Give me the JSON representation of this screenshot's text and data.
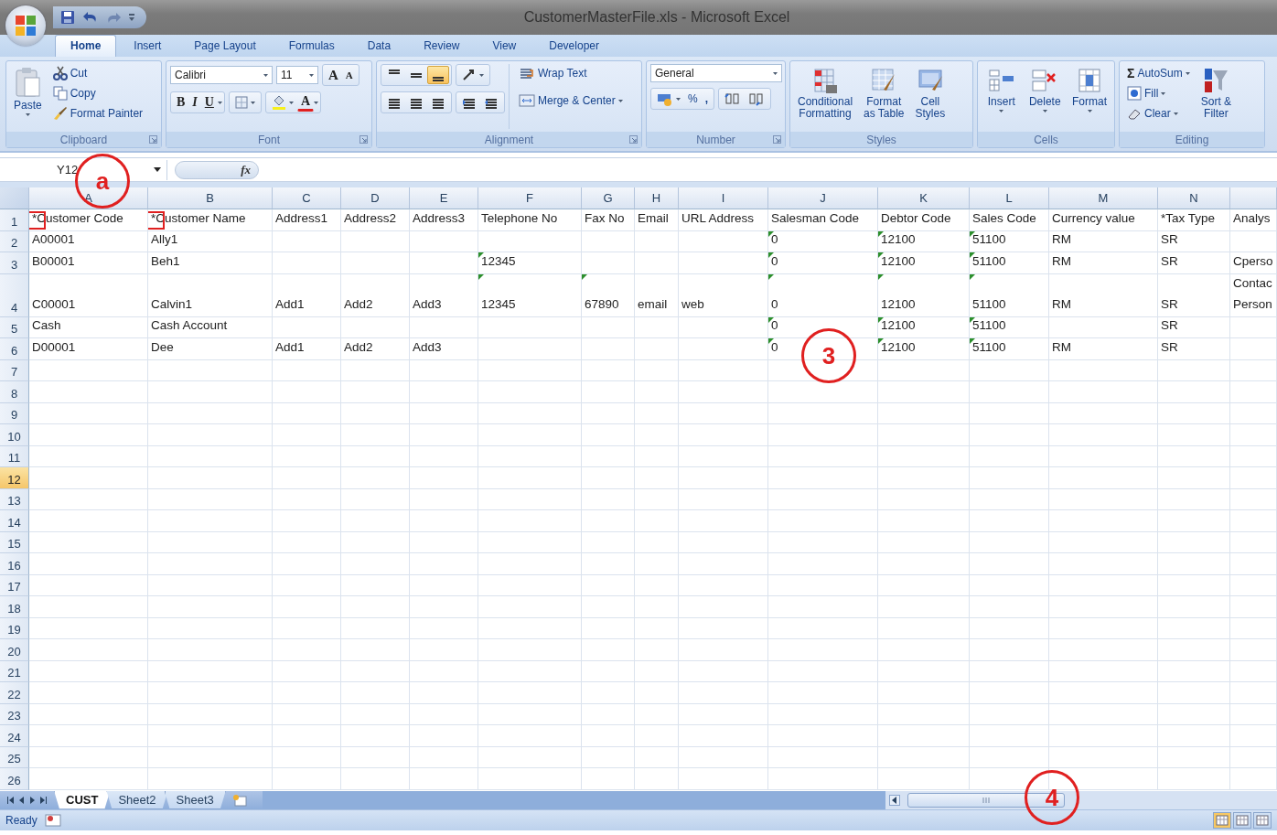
{
  "title_bar": {
    "title": "CustomerMasterFile.xls - Microsoft Excel"
  },
  "ribbon_tabs": [
    {
      "label": "Home",
      "selected": true
    },
    {
      "label": "Insert",
      "selected": false
    },
    {
      "label": "Page Layout",
      "selected": false
    },
    {
      "label": "Formulas",
      "selected": false
    },
    {
      "label": "Data",
      "selected": false
    },
    {
      "label": "Review",
      "selected": false
    },
    {
      "label": "View",
      "selected": false
    },
    {
      "label": "Developer",
      "selected": false
    }
  ],
  "ribbon": {
    "clipboard": {
      "label": "Clipboard",
      "paste": "Paste",
      "cut": "Cut",
      "copy": "Copy",
      "format_painter": "Format Painter"
    },
    "font": {
      "label": "Font",
      "font_name": "Calibri",
      "font_size": "11",
      "grow": "A",
      "shrink": "A",
      "bold": "B",
      "italic": "I",
      "underline": "U",
      "font_color": "A"
    },
    "alignment": {
      "label": "Alignment",
      "vertical_buttons": [
        {
          "selected": false
        },
        {
          "selected": false
        },
        {
          "selected": true
        }
      ],
      "wrap_text": "Wrap Text",
      "merge_center": "Merge & Center"
    },
    "number": {
      "label": "Number",
      "format": "General",
      "percent": "%",
      "comma": ","
    },
    "styles": {
      "label": "Styles",
      "buttons": [
        "Conditional\nFormatting",
        "Format\nas Table",
        "Cell\nStyles"
      ]
    },
    "cells": {
      "label": "Cells",
      "buttons": [
        "Insert",
        "Delete",
        "Format"
      ]
    },
    "editing": {
      "label": "Editing",
      "sigma": "Σ",
      "autosum": "AutoSum",
      "fill": "Fill",
      "clear": "Clear",
      "sort_filter": "Sort &\nFilter"
    }
  },
  "formula_bar": {
    "name_box": "Y12",
    "fx": "fx"
  },
  "sheet": {
    "columns": [
      "A",
      "B",
      "C",
      "D",
      "E",
      "F",
      "G",
      "H",
      "I",
      "J",
      "K",
      "L",
      "M",
      "N"
    ],
    "rows": [
      {
        "number": "1",
        "selected": false,
        "tall": false,
        "cells": [
          {
            "text": "*Customer Code",
            "boxed": true
          },
          {
            "text": "*Customer Name",
            "boxed": true
          },
          "Address1",
          "Address2",
          "Address3",
          "Telephone No",
          "Fax No",
          "Email",
          "URL Address",
          "Salesman Code",
          "Debtor Code",
          "Sales Code",
          "Currency value",
          "*Tax Type",
          "Analys"
        ]
      },
      {
        "number": "2",
        "selected": false,
        "tall": false,
        "cells": [
          "A00001",
          "Ally1",
          null,
          null,
          null,
          null,
          null,
          null,
          null,
          {
            "text": "0",
            "flagged": true
          },
          {
            "text": "12100",
            "flagged": true
          },
          {
            "text": "51100",
            "flagged": true
          },
          "RM",
          "SR",
          null
        ]
      },
      {
        "number": "3",
        "selected": false,
        "tall": false,
        "cells": [
          "B00001",
          "Beh1",
          null,
          null,
          null,
          {
            "text": "12345",
            "flagged": true
          },
          null,
          null,
          null,
          {
            "text": "0",
            "flagged": true
          },
          {
            "text": "12100",
            "flagged": true
          },
          {
            "text": "51100",
            "flagged": true
          },
          "RM",
          "SR",
          "Cperso"
        ]
      },
      {
        "number": "4",
        "selected": false,
        "tall": true,
        "cells": [
          "C00001",
          "Calvin1",
          "Add1",
          "Add2",
          "Add3",
          {
            "text": "12345",
            "flagged": true
          },
          {
            "text": "67890",
            "flagged": true
          },
          "email",
          "web",
          {
            "text": "0",
            "flagged": true
          },
          {
            "text": "12100",
            "flagged": true
          },
          {
            "text": "51100",
            "flagged": true
          },
          "RM",
          "SR",
          "Contac\nPerson"
        ]
      },
      {
        "number": "5",
        "selected": false,
        "tall": false,
        "cells": [
          "Cash",
          "Cash Account",
          null,
          null,
          null,
          null,
          null,
          null,
          null,
          {
            "text": "0",
            "flagged": true
          },
          {
            "text": "12100",
            "flagged": true
          },
          {
            "text": "51100",
            "flagged": true
          },
          null,
          "SR",
          null
        ]
      },
      {
        "number": "6",
        "selected": false,
        "tall": false,
        "cells": [
          "D00001",
          "Dee",
          "Add1",
          "Add2",
          "Add3",
          null,
          null,
          null,
          null,
          {
            "text": "0",
            "flagged": true
          },
          {
            "text": "12100",
            "flagged": true
          },
          {
            "text": "51100",
            "flagged": true
          },
          "RM",
          "SR",
          null
        ]
      },
      {
        "number": "7",
        "selected": false,
        "tall": false
      },
      {
        "number": "8",
        "selected": false,
        "tall": false
      },
      {
        "number": "9",
        "selected": false,
        "tall": false
      },
      {
        "number": "10",
        "selected": false,
        "tall": false
      },
      {
        "number": "11",
        "selected": false,
        "tall": false
      },
      {
        "number": "12",
        "selected": true,
        "tall": false
      },
      {
        "number": "13",
        "selected": false,
        "tall": false
      },
      {
        "number": "14",
        "selected": false,
        "tall": false
      },
      {
        "number": "15",
        "selected": false,
        "tall": false
      },
      {
        "number": "16",
        "selected": false,
        "tall": false
      },
      {
        "number": "17",
        "selected": false,
        "tall": false
      },
      {
        "number": "18",
        "selected": false,
        "tall": false
      },
      {
        "number": "19",
        "selected": false,
        "tall": false
      },
      {
        "number": "20",
        "selected": false,
        "tall": false
      },
      {
        "number": "21",
        "selected": false,
        "tall": false
      },
      {
        "number": "22",
        "selected": false,
        "tall": false
      },
      {
        "number": "23",
        "selected": false,
        "tall": false
      },
      {
        "number": "24",
        "selected": false,
        "tall": false
      },
      {
        "number": "25",
        "selected": false,
        "tall": false
      },
      {
        "number": "26",
        "selected": false,
        "tall": false
      }
    ]
  },
  "sheet_tabs": [
    {
      "label": "CUST",
      "selected": true
    },
    {
      "label": "Sheet2",
      "selected": false
    },
    {
      "label": "Sheet3",
      "selected": false
    }
  ],
  "status_bar": {
    "text": "Ready"
  },
  "callouts": [
    {
      "label": "a"
    },
    {
      "label": "3"
    },
    {
      "label": "4"
    }
  ]
}
